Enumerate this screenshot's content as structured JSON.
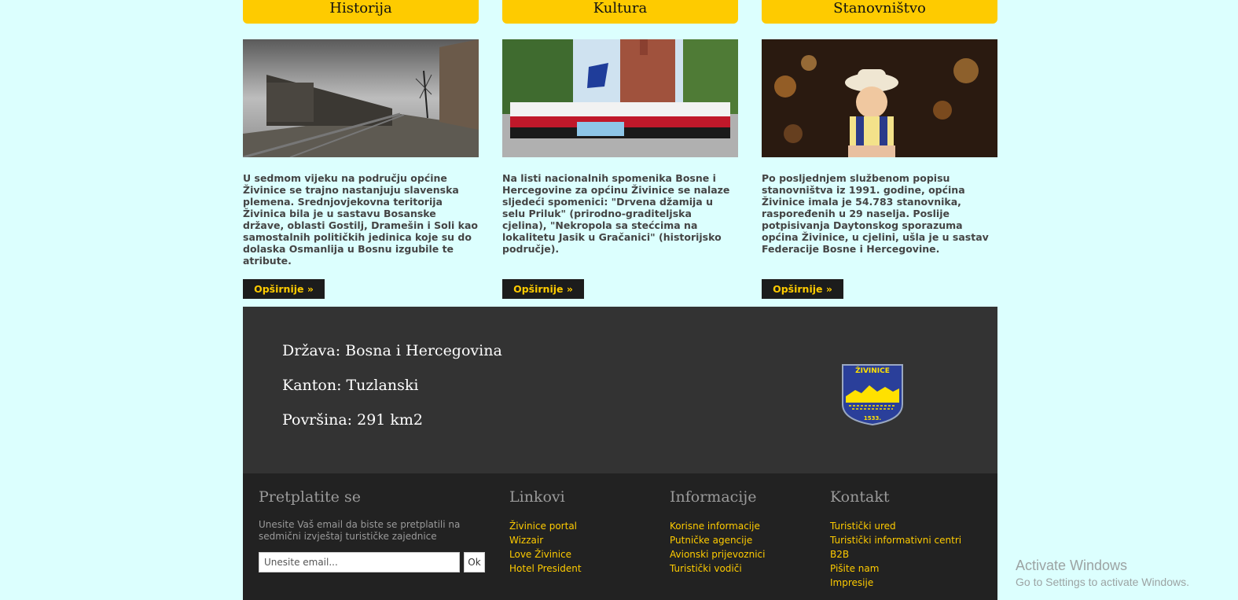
{
  "columns": [
    {
      "title": "Historija",
      "image": "train-railway-photo",
      "text": "U sedmom vijeku na području općine Živinice se trajno nastanjuju slavenska plemena. Srednjovjekovna teritorija Živinica bila je u sastavu Bosanske države, oblasti Gostilj, Dramešin i Soli kao samostalnih političkih jedinica koje su do dolaska Osmanlija u Bosnu izgubile te atribute.",
      "more": "Opširnije »"
    },
    {
      "title": "Kultura",
      "image": "folklore-group-photo",
      "text": "Na listi nacionalnih spomenika Bosne i Hercegovine za općinu Živinice se nalaze sljedeći spomenici: \"Drvena džamija u selu Priluk\" (prirodno-graditeljska cjelina), \"Nekropola sa stećcima na lokalitetu Jasik u Gračanici\" (historijsko područje).",
      "more": "Opširnije »"
    },
    {
      "title": "Stanovništvo",
      "image": "child-on-shoulders-photo",
      "text": "Po posljednjem službenom popisu stanovništva iz 1991. godine, općina Živinice imala je 54.783 stanovnika, raspoređenih u 29 naselja. Poslije potpisivanja Daytonskog sporazuma općina Živinice, u cjelini, ušla je u sastav Federacije Bosne i Hercegovine.",
      "more": "Opširnije »"
    }
  ],
  "info": {
    "country": "Država: Bosna i Hercegovina",
    "canton": "Kanton: Tuzlanski",
    "area": "Površina: 291 km2",
    "crest_text": "ŽIVINICE",
    "crest_year": "1533."
  },
  "footer": {
    "subscribe": {
      "title": "Pretplatite se",
      "description": "Unesite Vaš email da biste se pretplatili na sedmični izvještaj turističke zajednice",
      "placeholder": "Unesite email...",
      "button": "Ok"
    },
    "links": {
      "title": "Linkovi",
      "items": [
        "Živinice portal",
        "Wizzair",
        "Love Živinice",
        "Hotel President"
      ]
    },
    "info": {
      "title": "Informacije",
      "items": [
        "Korisne informacije",
        "Putničke agencije",
        "Avionski prijevoznici",
        "Turistički vodiči"
      ]
    },
    "contact": {
      "title": "Kontakt",
      "items": [
        "Turistički ured",
        "Turistički informativni centri",
        "B2B",
        "Pišite nam",
        "Impresije"
      ]
    }
  },
  "watermark": {
    "line1": "Activate Windows",
    "line2": "Go to Settings to activate Windows."
  },
  "colors": {
    "background": "#dcfffe",
    "accent": "#fecb00",
    "panel": "#333333",
    "footer": "#222222"
  }
}
